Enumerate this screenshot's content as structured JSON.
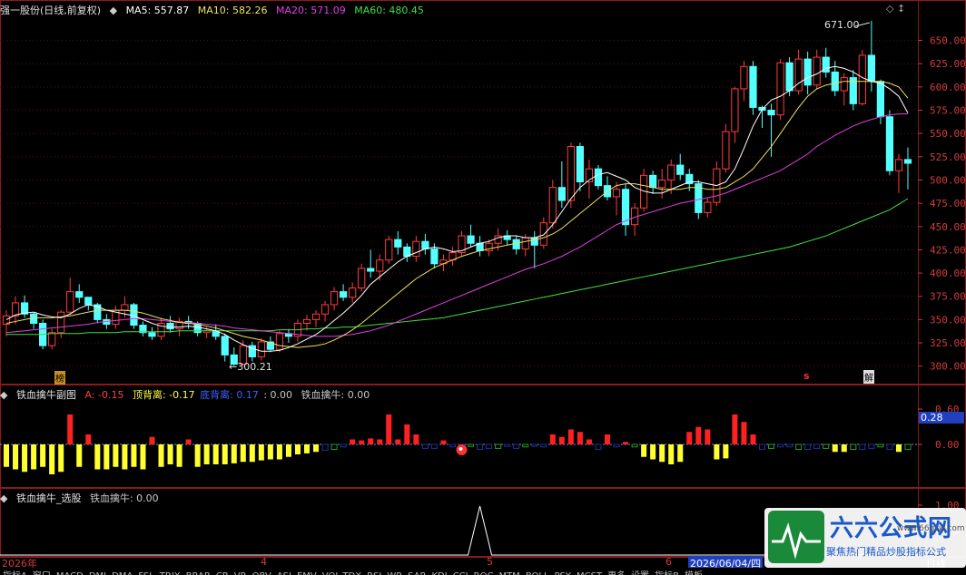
{
  "main_panel": {
    "title": "强一股份(日线,前复权)",
    "ma": [
      {
        "label": "MA5: 557.87",
        "color": "#ffffff"
      },
      {
        "label": "MA10: 582.26",
        "color": "#f0e060"
      },
      {
        "label": "MA20: 571.09",
        "color": "#e040e0"
      },
      {
        "label": "MA60: 480.45",
        "color": "#40e040"
      }
    ],
    "high_label": "671.00",
    "low_label": "←300.21",
    "badge_bang": "榜",
    "badge_s": "s",
    "badge_jie": "解"
  },
  "sub_panel1": {
    "title": "铁血擒牛副图",
    "items": [
      {
        "label": "A: -0.15",
        "color": "#ff4040"
      },
      {
        "label": "顶背离: -0.17",
        "color": "#ffff40"
      },
      {
        "label": "底背离: 0.17",
        "color": "#4060ff"
      },
      {
        "label": ": 0.00",
        "color": "#c8c8c8"
      },
      {
        "label": "铁血擒牛: 0.00",
        "color": "#c8c8c8"
      }
    ],
    "current_value": "0.28"
  },
  "sub_panel2": {
    "title": "铁血擒牛_选股",
    "items": [
      {
        "label": "铁血擒牛: 0.00",
        "color": "#c8c8c8"
      }
    ]
  },
  "date_bar": {
    "labels": [
      "2026年",
      "4",
      "5",
      "6"
    ],
    "selected_date": "2026/06/04/四",
    "period": "日线"
  },
  "bottom_tabs": [
    "指标A",
    "窗口",
    "MACD",
    "DMI",
    "DMA",
    "FSL",
    "TRIX",
    "BRAR",
    "CR",
    "VR",
    "OBV",
    "ASI",
    "EMV",
    "VOL-TDX",
    "RSI",
    "WR",
    "SAR",
    "KDJ",
    "CCI",
    "ROC",
    "MTM",
    "BOLL",
    "PSY",
    "MCST",
    "更多",
    "设置",
    "指标B",
    "模板"
  ],
  "watermark": {
    "title": "六六公式网",
    "subtitle": "聚焦热门精品炒股指标公式",
    "url": "www.66gsw.com"
  },
  "chart_data": [
    {
      "type": "candlestick",
      "title": "强一股份(日线,前复权)",
      "y_ticks": [
        300,
        325,
        350,
        375,
        400,
        425,
        450,
        475,
        500,
        525,
        550,
        575,
        600,
        625,
        650
      ],
      "ylim": [
        288,
        672
      ],
      "annotations": [
        {
          "text": "671.00",
          "kind": "high"
        },
        {
          "text": "300.21",
          "kind": "low"
        }
      ],
      "series": [
        {
          "name": "MA5",
          "color": "#ffffff"
        },
        {
          "name": "MA10",
          "color": "#f0e060"
        },
        {
          "name": "MA20",
          "color": "#e040e0"
        },
        {
          "name": "MA60",
          "color": "#40e040"
        }
      ],
      "candles": [
        [
          345,
          360,
          332,
          354
        ],
        [
          354,
          375,
          345,
          368
        ],
        [
          368,
          376,
          352,
          356
        ],
        [
          356,
          358,
          340,
          346
        ],
        [
          346,
          350,
          318,
          322
        ],
        [
          322,
          340,
          318,
          336
        ],
        [
          336,
          360,
          330,
          358
        ],
        [
          358,
          395,
          355,
          380
        ],
        [
          380,
          388,
          368,
          374
        ],
        [
          374,
          372,
          360,
          366
        ],
        [
          366,
          368,
          346,
          350
        ],
        [
          350,
          356,
          340,
          345
        ],
        [
          345,
          365,
          340,
          360
        ],
        [
          360,
          375,
          352,
          366
        ],
        [
          366,
          368,
          340,
          344
        ],
        [
          344,
          348,
          332,
          336
        ],
        [
          336,
          342,
          328,
          332
        ],
        [
          332,
          352,
          328,
          346
        ],
        [
          346,
          354,
          336,
          340
        ],
        [
          340,
          352,
          332,
          348
        ],
        [
          348,
          354,
          340,
          346
        ],
        [
          346,
          348,
          332,
          336
        ],
        [
          336,
          342,
          330,
          338
        ],
        [
          338,
          345,
          328,
          332
        ],
        [
          332,
          335,
          305,
          312
        ],
        [
          312,
          320,
          300,
          302
        ],
        [
          302,
          328,
          300,
          322
        ],
        [
          322,
          326,
          305,
          310
        ],
        [
          310,
          330,
          306,
          326
        ],
        [
          326,
          332,
          315,
          318
        ],
        [
          318,
          338,
          315,
          335
        ],
        [
          335,
          340,
          325,
          332
        ],
        [
          332,
          350,
          326,
          346
        ],
        [
          346,
          355,
          338,
          350
        ],
        [
          350,
          360,
          342,
          356
        ],
        [
          356,
          370,
          348,
          366
        ],
        [
          366,
          385,
          360,
          380
        ],
        [
          380,
          388,
          370,
          374
        ],
        [
          374,
          390,
          368,
          384
        ],
        [
          384,
          410,
          380,
          405
        ],
        [
          405,
          425,
          395,
          402
        ],
        [
          402,
          420,
          392,
          414
        ],
        [
          414,
          440,
          410,
          436
        ],
        [
          436,
          445,
          420,
          428
        ],
        [
          428,
          432,
          412,
          418
        ],
        [
          418,
          440,
          412,
          434
        ],
        [
          434,
          442,
          420,
          426
        ],
        [
          426,
          432,
          405,
          410
        ],
        [
          410,
          420,
          402,
          414
        ],
        [
          414,
          428,
          408,
          422
        ],
        [
          422,
          445,
          418,
          440
        ],
        [
          440,
          452,
          428,
          432
        ],
        [
          432,
          440,
          418,
          424
        ],
        [
          424,
          436,
          418,
          432
        ],
        [
          432,
          448,
          424,
          440
        ],
        [
          440,
          446,
          430,
          436
        ],
        [
          436,
          440,
          420,
          426
        ],
        [
          426,
          442,
          418,
          438
        ],
        [
          438,
          445,
          405,
          430
        ],
        [
          430,
          460,
          426,
          454
        ],
        [
          454,
          500,
          448,
          492
        ],
        [
          492,
          520,
          470,
          478
        ],
        [
          478,
          540,
          470,
          536
        ],
        [
          536,
          540,
          488,
          498
        ],
        [
          498,
          522,
          480,
          512
        ],
        [
          512,
          516,
          490,
          494
        ],
        [
          494,
          504,
          478,
          482
        ],
        [
          482,
          498,
          462,
          490
        ],
        [
          490,
          496,
          440,
          452
        ],
        [
          452,
          475,
          440,
          470
        ],
        [
          470,
          512,
          466,
          505
        ],
        [
          505,
          510,
          485,
          492
        ],
        [
          492,
          512,
          480,
          500
        ],
        [
          500,
          522,
          485,
          516
        ],
        [
          516,
          528,
          500,
          506
        ],
        [
          506,
          512,
          488,
          496
        ],
        [
          496,
          500,
          458,
          465
        ],
        [
          465,
          480,
          460,
          476
        ],
        [
          476,
          520,
          472,
          512
        ],
        [
          512,
          560,
          508,
          552
        ],
        [
          552,
          600,
          540,
          598
        ],
        [
          598,
          628,
          585,
          622
        ],
        [
          622,
          628,
          570,
          578
        ],
        [
          578,
          580,
          556,
          575
        ],
        [
          575,
          582,
          525,
          570
        ],
        [
          570,
          630,
          565,
          626
        ],
        [
          626,
          632,
          590,
          596
        ],
        [
          596,
          640,
          592,
          630
        ],
        [
          630,
          638,
          592,
          602
        ],
        [
          602,
          640,
          598,
          632
        ],
        [
          632,
          642,
          610,
          616
        ],
        [
          616,
          628,
          590,
          596
        ],
        [
          596,
          615,
          580,
          610
        ],
        [
          610,
          618,
          575,
          582
        ],
        [
          582,
          640,
          580,
          634
        ],
        [
          634,
          671,
          595,
          606
        ],
        [
          606,
          608,
          560,
          568
        ],
        [
          568,
          575,
          505,
          510
        ],
        [
          510,
          528,
          486,
          522
        ],
        [
          522,
          535,
          490,
          518
        ]
      ],
      "ma5": [
        350,
        355,
        357,
        358,
        355,
        353,
        352,
        356,
        362,
        366,
        364,
        360,
        358,
        356,
        354,
        350,
        346,
        343,
        342,
        342,
        343,
        342,
        340,
        338,
        334,
        328,
        323,
        319,
        316,
        316,
        317,
        320,
        324,
        329,
        334,
        341,
        349,
        357,
        366,
        376,
        388,
        396,
        404,
        412,
        418,
        422,
        426,
        428,
        426,
        423,
        424,
        428,
        432,
        434,
        438,
        440,
        440,
        438,
        438,
        441,
        452,
        466,
        480,
        492,
        500,
        506,
        508,
        504,
        500,
        492,
        488,
        486,
        486,
        490,
        494,
        498,
        498,
        496,
        494,
        498,
        512,
        534,
        558,
        576,
        586,
        590,
        596,
        604,
        610,
        614,
        620,
        622,
        620,
        616,
        610,
        606,
        604,
        598,
        590,
        572
      ],
      "ma10": [
        346,
        348,
        350,
        352,
        352,
        352,
        353,
        354,
        356,
        358,
        360,
        360,
        360,
        360,
        359,
        357,
        354,
        351,
        349,
        347,
        346,
        345,
        343,
        341,
        338,
        335,
        332,
        330,
        328,
        325,
        322,
        321,
        320,
        321,
        322,
        324,
        328,
        333,
        339,
        346,
        354,
        362,
        370,
        378,
        386,
        394,
        400,
        406,
        410,
        414,
        418,
        421,
        424,
        426,
        428,
        430,
        432,
        434,
        436,
        438,
        442,
        448,
        456,
        464,
        472,
        480,
        488,
        494,
        496,
        496,
        494,
        492,
        490,
        490,
        490,
        492,
        492,
        490,
        490,
        492,
        498,
        504,
        512,
        524,
        536,
        550,
        564,
        578,
        590,
        598,
        602,
        604,
        606,
        606,
        606,
        606,
        606,
        604,
        600,
        588
      ],
      "ma20": [
        336,
        337,
        338,
        339,
        340,
        341,
        342,
        343,
        344,
        345,
        347,
        348,
        349,
        350,
        351,
        351,
        350,
        349,
        348,
        347,
        347,
        346,
        345,
        344,
        343,
        341,
        340,
        339,
        338,
        337,
        336,
        335,
        334,
        333,
        332,
        332,
        332,
        333,
        334,
        336,
        338,
        341,
        344,
        348,
        352,
        356,
        360,
        364,
        368,
        372,
        376,
        380,
        384,
        388,
        392,
        396,
        400,
        404,
        407,
        410,
        414,
        418,
        423,
        428,
        434,
        440,
        446,
        452,
        456,
        460,
        463,
        466,
        469,
        472,
        475,
        477,
        479,
        481,
        483,
        486,
        490,
        494,
        498,
        502,
        506,
        510,
        516,
        522,
        528,
        536,
        542,
        548,
        553,
        558,
        562,
        565,
        568,
        570,
        571,
        571
      ],
      "ma60": [
        334,
        334,
        334,
        334,
        334,
        335,
        335,
        335,
        335,
        336,
        336,
        336,
        336,
        337,
        337,
        337,
        337,
        337,
        337,
        338,
        338,
        338,
        338,
        338,
        338,
        338,
        338,
        338,
        338,
        338,
        339,
        339,
        339,
        340,
        340,
        341,
        341,
        342,
        342,
        343,
        344,
        345,
        346,
        347,
        348,
        349,
        350,
        351,
        352,
        354,
        356,
        358,
        360,
        362,
        364,
        366,
        368,
        370,
        372,
        374,
        376,
        378,
        380,
        382,
        384,
        386,
        388,
        390,
        392,
        394,
        396,
        398,
        400,
        402,
        404,
        406,
        408,
        410,
        412,
        414,
        416,
        418,
        420,
        422,
        424,
        426,
        428,
        431,
        434,
        437,
        440,
        444,
        448,
        452,
        456,
        460,
        464,
        468,
        474,
        480
      ]
    },
    {
      "type": "bar",
      "title": "铁血擒牛副图",
      "y_ticks": [
        0.6,
        0.28,
        0.0
      ],
      "series": [
        {
          "name": "A",
          "color": "#ff4040"
        },
        {
          "name": "顶背离",
          "color": "#ffff40"
        },
        {
          "name": "底背离",
          "color": "#4060ff"
        }
      ],
      "values": [
        -0.45,
        -0.5,
        -0.55,
        -0.5,
        -0.45,
        -0.6,
        -0.55,
        0.6,
        -0.45,
        0.2,
        -0.5,
        -0.5,
        -0.45,
        -0.5,
        -0.45,
        -0.5,
        0.15,
        -0.45,
        -0.4,
        -0.45,
        0.1,
        -0.45,
        -0.4,
        -0.4,
        -0.4,
        -0.38,
        -0.35,
        -0.35,
        -0.32,
        -0.3,
        -0.3,
        -0.25,
        -0.2,
        -0.18,
        -0.15,
        -0.12,
        -0.1,
        -0.05,
        0.1,
        0.08,
        0.12,
        0.1,
        0.6,
        0.1,
        0.4,
        0.2,
        -0.08,
        -0.08,
        0.08,
        -0.05,
        -0.03,
        -0.04,
        -0.1,
        -0.08,
        -0.08,
        -0.04,
        -0.08,
        -0.05,
        0.0,
        -0.05,
        0.2,
        0.15,
        0.3,
        0.25,
        0.1,
        -0.1,
        0.2,
        -0.05,
        0.05,
        -0.05,
        -0.25,
        -0.3,
        -0.35,
        -0.4,
        -0.35,
        0.25,
        0.35,
        0.3,
        -0.3,
        -0.28,
        0.6,
        0.45,
        0.2,
        -0.1,
        -0.08,
        -0.05,
        -0.05,
        -0.1,
        -0.1,
        -0.08,
        -0.08,
        -0.15,
        -0.15,
        -0.1,
        -0.1,
        -0.08,
        -0.05,
        -0.1,
        -0.15,
        -0.1
      ]
    },
    {
      "type": "line",
      "title": "铁血擒牛_选股",
      "y_ticks": [
        1.0,
        0.5
      ],
      "ylim": [
        0,
        1
      ],
      "series": [
        {
          "name": "铁血擒牛",
          "color": "#ffffff",
          "signal_index": 52,
          "signal_value": 1.0
        }
      ]
    }
  ]
}
